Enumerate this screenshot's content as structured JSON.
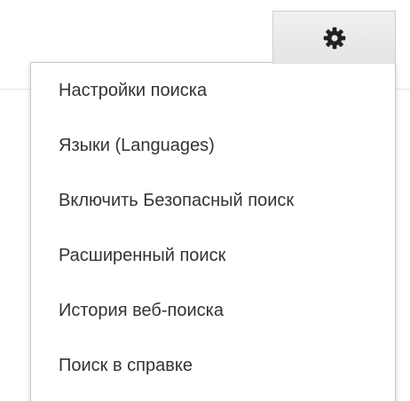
{
  "settings": {
    "icon": "gear-icon"
  },
  "menu": {
    "items": [
      {
        "label": "Настройки поиска"
      },
      {
        "label": "Языки  (Languages)"
      },
      {
        "label": "Включить Безопасный поиск"
      },
      {
        "label": "Расширенный поиск"
      },
      {
        "label": "История веб-поиска"
      },
      {
        "label": "Поиск в справке"
      }
    ]
  },
  "colors": {
    "text": "#333333",
    "border": "#c6c6c6",
    "button_bg": "#e9e9e9",
    "gear": "#222222"
  }
}
